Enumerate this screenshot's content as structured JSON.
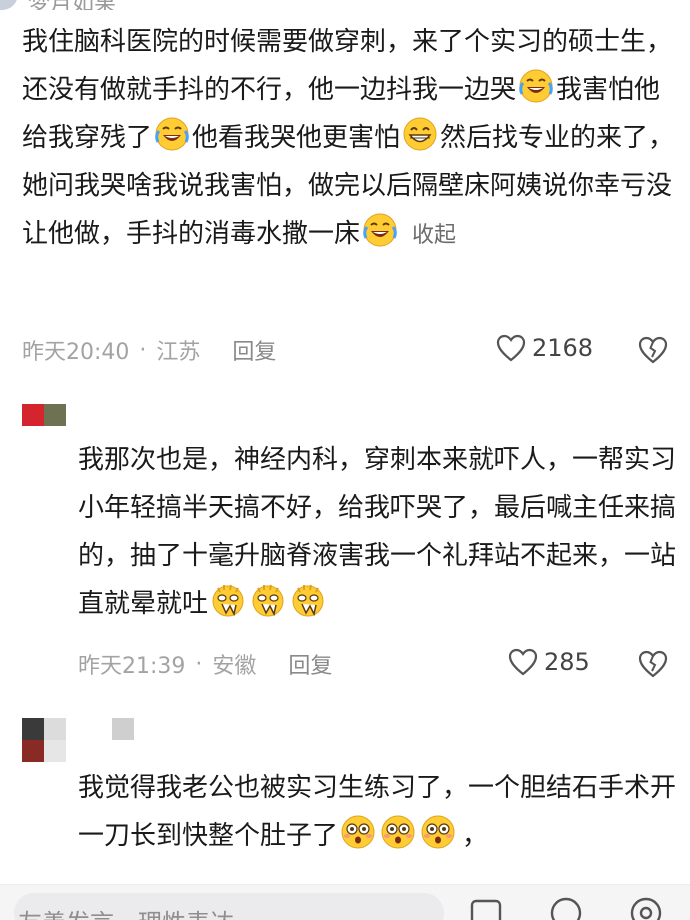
{
  "top": {
    "username": "梦月如果"
  },
  "comments": [
    {
      "text_line1": "我住脑科医院的时候需要做穿刺，来了个实习的硕士生，还没有做就手抖的不行，他一边抖我一边哭",
      "text_seg2": "我害怕他给我穿残了",
      "text_seg3": "他看我哭他更害怕",
      "text_line3": "然后找专业的来了，她问我哭啥我说我害怕，做完以后隔壁床阿姨说你幸亏没让他做，手抖的消毒水撒一床",
      "collapse_label": "收起",
      "time": "昨天20:40",
      "location": "江苏",
      "reply_label": "回复",
      "likes": "2168",
      "emoji": [
        "laugh-cry-emoji",
        "grin-emoji"
      ]
    },
    {
      "text": "我那次也是，神经内科，穿刺本来就吓人，一帮实习小年轻搞半天搞不好，给我吓哭了，最后喊主任来搞的，抽了十毫升脑脊液害我一个礼拜站不起来，一站直就晕就吐",
      "time": "昨天21:39",
      "location": "安徽",
      "reply_label": "回复",
      "likes": "285",
      "emoji": [
        "dizzy-emoji"
      ]
    },
    {
      "text": "我觉得我老公也被实习生练习了，一个胆结石手术开一刀长到快整个肚子了",
      "trailing": "，",
      "emoji": [
        "flushed-emoji"
      ]
    }
  ],
  "bottom_bar": {
    "input_placeholder": "友善发言，理性表达"
  },
  "colors": {
    "text": "#1a1a1a",
    "meta": "#a3a3a3",
    "emoji_yellow": "#ffcc33",
    "bottom_bar_bg": "#f5f5f6"
  }
}
